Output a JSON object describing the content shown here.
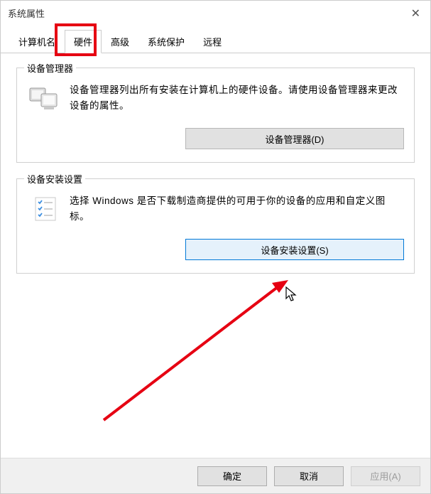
{
  "window": {
    "title": "系统属性"
  },
  "tabs": {
    "computer_name": "计算机名",
    "hardware": "硬件",
    "advanced": "高级",
    "system_protection": "系统保护",
    "remote": "远程"
  },
  "device_manager": {
    "legend": "设备管理器",
    "text": "设备管理器列出所有安装在计算机上的硬件设备。请使用设备管理器来更改设备的属性。",
    "button": "设备管理器(D)"
  },
  "install_settings": {
    "legend": "设备安装设置",
    "text": "选择 Windows 是否下载制造商提供的可用于你的设备的应用和自定义图标。",
    "button": "设备安装设置(S)"
  },
  "bottom": {
    "ok": "确定",
    "cancel": "取消",
    "apply": "应用(A)"
  }
}
